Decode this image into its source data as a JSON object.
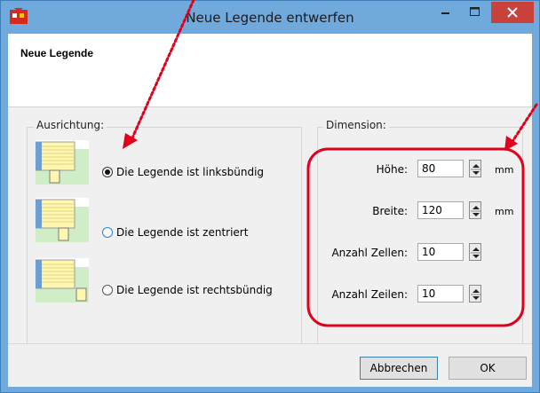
{
  "window": {
    "title": "Neue Legende entwerfen",
    "accent": "#70a9dc",
    "close_color": "#c8413a"
  },
  "header": {
    "title": "Neue Legende"
  },
  "alignment": {
    "group_label": "Ausrichtung:",
    "options": [
      {
        "label": "Die Legende ist linksbündig",
        "selected": true
      },
      {
        "label": "Die Legende ist zentriert",
        "selected": false
      },
      {
        "label": "Die Legende ist rechtsbündig",
        "selected": false
      }
    ]
  },
  "dimension": {
    "group_label": "Dimension:",
    "fields": [
      {
        "label": "Höhe:",
        "value": "80",
        "unit": "mm"
      },
      {
        "label": "Breite:",
        "value": "120",
        "unit": "mm"
      },
      {
        "label": "Anzahl Zellen:",
        "value": "10",
        "unit": ""
      },
      {
        "label": "Anzahl Zeilen:",
        "value": "10",
        "unit": ""
      }
    ]
  },
  "buttons": {
    "cancel": "Abbrechen",
    "ok": "OK"
  },
  "annotation": {
    "color": "#e0001b"
  }
}
